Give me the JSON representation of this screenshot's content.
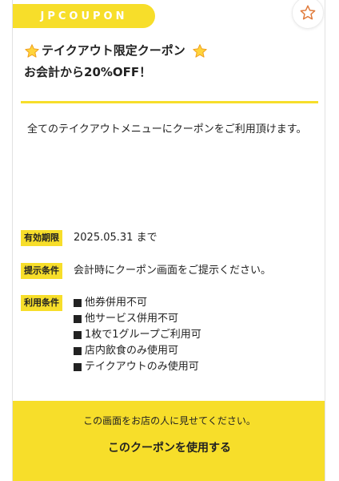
{
  "brand": {
    "name": "JPCOUPON",
    "color": "#f7de2a"
  },
  "favorite": {
    "icon": "star-outline-icon",
    "color": "#e07a3a"
  },
  "coupon": {
    "title_line1": "テイクアウト限定クーポン",
    "title_line2": "お会計から20%OFF！",
    "title_icon": "star-emoji-icon",
    "description": "全てのテイクアウトメニューにクーポンをご利用頂けます。"
  },
  "conditions": {
    "validity": {
      "label": "有効期限",
      "value": "2025.05.31 まで"
    },
    "presentation": {
      "label": "提示条件",
      "value": "会計時にクーポン画面をご提示ください。"
    },
    "terms": {
      "label": "利用条件",
      "items": [
        "他券併用不可",
        "他サービス併用不可",
        "1枚で1グループご利用可",
        "店内飲食のみ使用可",
        "テイクアウトのみ使用可"
      ]
    }
  },
  "footer": {
    "notice": "この画面をお店の人に見せてください。",
    "use_button": "このクーポンを使用する"
  }
}
